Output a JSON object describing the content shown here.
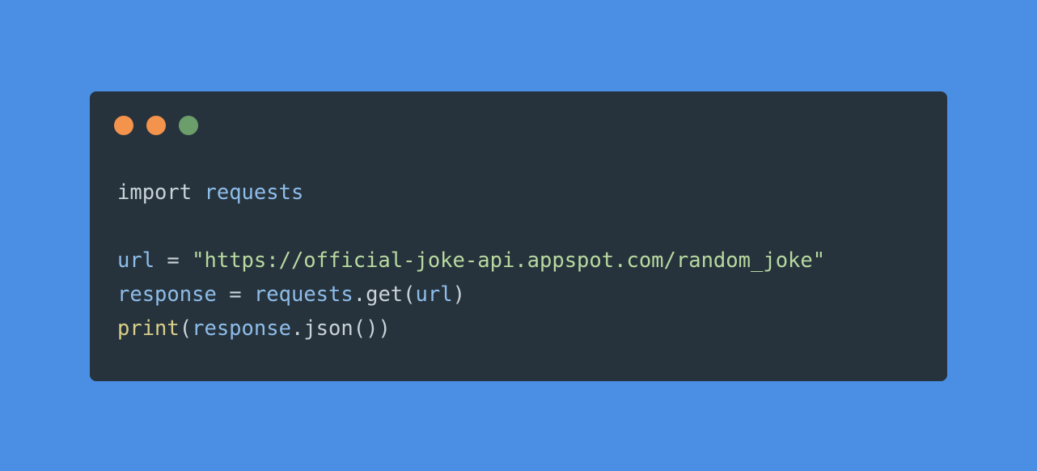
{
  "colors": {
    "background": "#4a8fe4",
    "window": "#26333c",
    "dot_close": "#f4934c",
    "dot_minimize": "#f4934c",
    "dot_maximize": "#6c9e6b"
  },
  "window_controls": [
    "close-dot",
    "minimize-dot",
    "maximize-dot"
  ],
  "code": {
    "line1": {
      "keyword": "import",
      "module": "requests"
    },
    "line3": {
      "var": "url",
      "op": "=",
      "string": "\"https://official-joke-api.appspot.com/random_joke\""
    },
    "line4": {
      "var": "response",
      "op": "=",
      "obj": "requests",
      "dot": ".",
      "method": "get",
      "open": "(",
      "arg": "url",
      "close": ")"
    },
    "line5": {
      "func": "print",
      "open": "(",
      "obj": "response",
      "dot": ".",
      "method": "json",
      "call": "()",
      "close": ")"
    }
  }
}
